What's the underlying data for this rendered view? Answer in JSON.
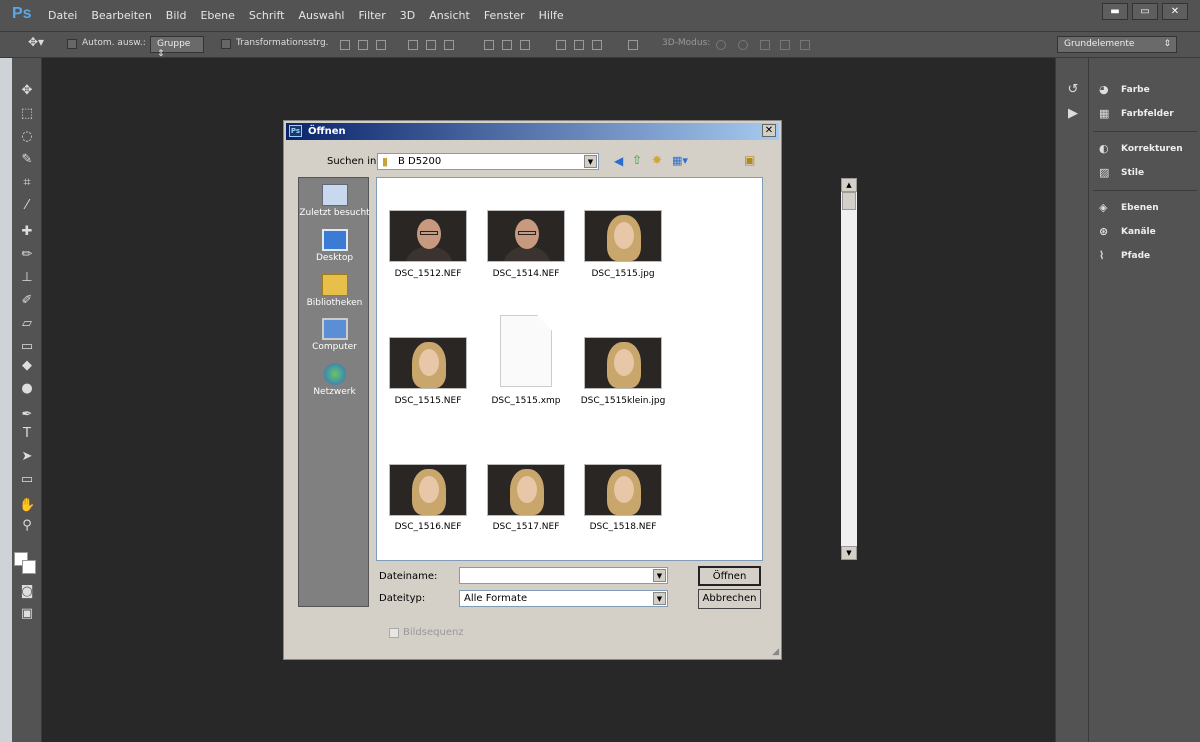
{
  "app": {
    "logo": "Ps"
  },
  "menu": [
    "Datei",
    "Bearbeiten",
    "Bild",
    "Ebene",
    "Schrift",
    "Auswahl",
    "Filter",
    "3D",
    "Ansicht",
    "Fenster",
    "Hilfe"
  ],
  "window_controls": [
    "▬",
    "▭",
    "✕"
  ],
  "options": {
    "auto_select": "Autom. ausw.:",
    "group": "Gruppe",
    "transform": "Transformationsstrg.",
    "mode3d": "3D-Modus:",
    "workspace": "Grundelemente"
  },
  "panels": [
    "Farbe",
    "Farbfelder",
    "Korrekturen",
    "Stile",
    "Ebenen",
    "Kanäle",
    "Pfade"
  ],
  "dialog": {
    "title": "Öffnen",
    "look_in_label": "Suchen in:",
    "look_in_value": "B D5200",
    "places": [
      "Zuletzt besucht",
      "Desktop",
      "Bibliotheken",
      "Computer",
      "Netzwerk"
    ],
    "files": [
      "DSC_1512.NEF",
      "DSC_1514.NEF",
      "DSC_1515.jpg",
      "DSC_1515.NEF",
      "DSC_1515.xmp",
      "DSC_1515klein.jpg",
      "DSC_1516.NEF",
      "DSC_1517.NEF",
      "DSC_1518.NEF"
    ],
    "filename_label": "Dateiname:",
    "filename_value": "",
    "filetype_label": "Dateityp:",
    "filetype_value": "Alle Formate",
    "open_button": "Öffnen",
    "cancel_button": "Abbrechen",
    "sequence_label": "Bildsequenz"
  }
}
